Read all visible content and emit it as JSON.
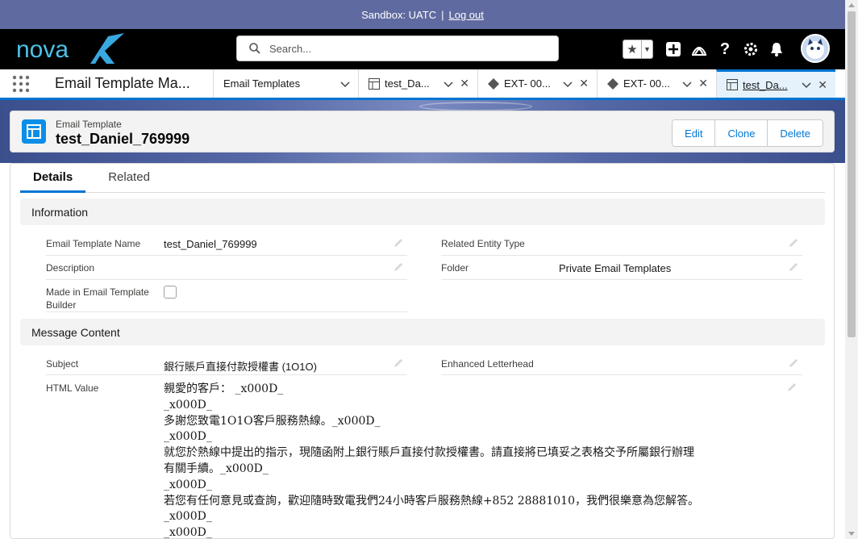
{
  "sandbox": {
    "label": "Sandbox: UATC",
    "separator": "|",
    "logout": "Log out"
  },
  "header": {
    "logo_text": "nova",
    "search_placeholder": "Search...",
    "icons": [
      "favorites-star-icon",
      "favorites-list-icon",
      "global-actions-plus-icon",
      "trailhead-icon",
      "help-icon",
      "setup-gear-icon",
      "notifications-bell-icon",
      "user-avatar"
    ]
  },
  "nav": {
    "app_name": "Email Template Ma...",
    "tabs": [
      {
        "label": "Email Templates",
        "icon": "",
        "active": false,
        "closable": false
      },
      {
        "label": "test_Da...",
        "icon": "email-template-icon",
        "active": false,
        "closable": true
      },
      {
        "label": "EXT- 00...",
        "icon": "diamond-icon",
        "active": false,
        "closable": true
      },
      {
        "label": "EXT- 00...",
        "icon": "diamond-icon",
        "active": false,
        "closable": true
      },
      {
        "label": "test_Da...",
        "icon": "email-template-icon",
        "active": true,
        "closable": true
      }
    ]
  },
  "record": {
    "type_label": "Email Template",
    "title": "test_Daniel_769999",
    "actions": {
      "edit": "Edit",
      "clone": "Clone",
      "delete": "Delete"
    }
  },
  "subtabs": {
    "details": "Details",
    "related": "Related"
  },
  "information": {
    "heading": "Information",
    "template_name_label": "Email Template Name",
    "template_name_value": "test_Daniel_769999",
    "description_label": "Description",
    "description_value": "",
    "builder_label": "Made in Email Template Builder",
    "builder_checked": false,
    "related_entity_label": "Related Entity Type",
    "related_entity_value": "",
    "folder_label": "Folder",
    "folder_value": "Private Email Templates"
  },
  "message": {
    "heading": "Message Content",
    "subject_label": "Subject",
    "subject_value": "銀行賬戶直接付款授權書 (1O1O)",
    "letterhead_label": "Enhanced Letterhead",
    "letterhead_value": "",
    "html_label": "HTML Value",
    "html_lines": [
      "親愛的客戶： _x000D_",
      "_x000D_",
      "多謝您致電1O1O客戶服務熱線。_x000D_",
      "_x000D_",
      "就您於熱線中提出的指示，現隨函附上銀行賬戶直接付款授權書。請直接將已填妥之表格交予所屬銀行辦理",
      "有關手續。_x000D_",
      "_x000D_",
      "若您有任何意見或查詢，歡迎隨時致電我們24小時客戶服務熱線+852 28881010，我們很樂意為您解答。",
      "_x000D_",
      "_x000D_"
    ]
  },
  "colors": {
    "brand": "#0176d3",
    "sandbox_bar": "#5f6aa0",
    "header_bg": "#000000",
    "record_icon": "#0b8ee6"
  }
}
